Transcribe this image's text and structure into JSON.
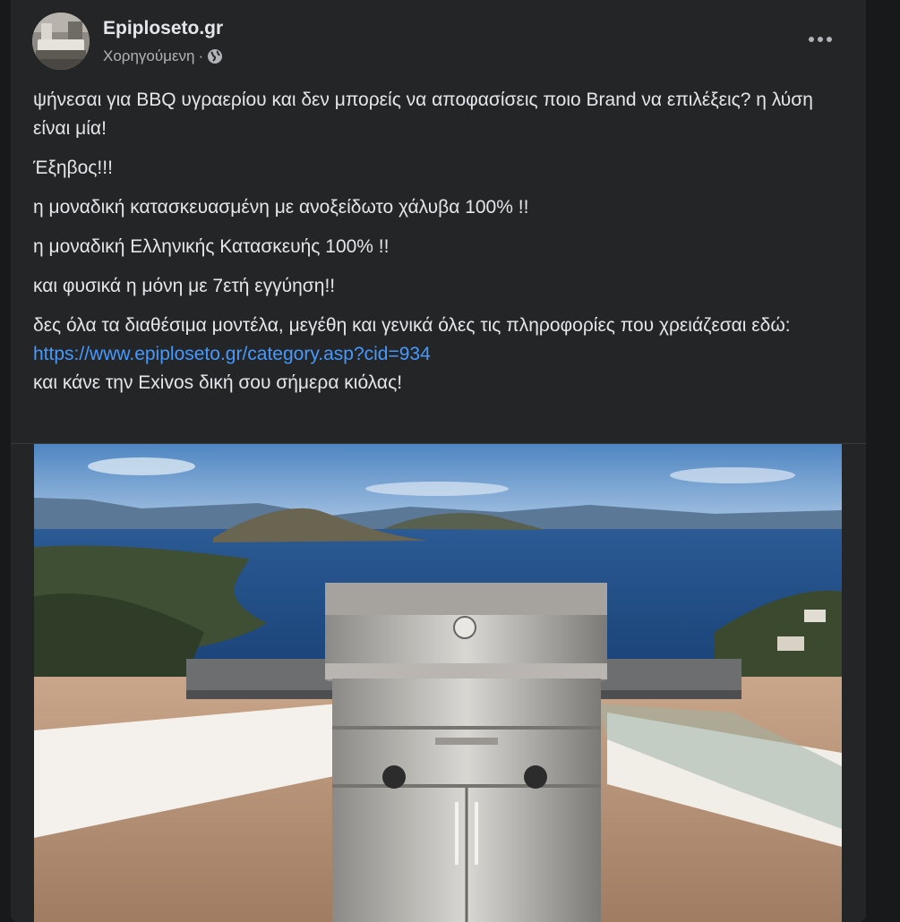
{
  "post": {
    "page_name": "Epiploseto.gr",
    "sponsored_label": "Χορηγούμενη",
    "separator": "·",
    "privacy_icon": "globe-icon",
    "more_icon": "more-options-icon",
    "lines": {
      "intro": "ψήνεσαι για BBQ υγραερίου και δεν μπορείς να αποφασίσεις ποιο Brand να επιλέξεις? η λύση είναι μία!",
      "brand": " Έξηβος!!!",
      "steel": "η μοναδική κατασκευασμένη με ανοξείδωτο χάλυβα 100% !!",
      "greek": "η μοναδική Ελληνικής Κατασκευής 100% !!",
      "warranty": "και φυσικά η μόνη με 7ετή εγγύηση!!",
      "models": "δες όλα τα διαθέσιμα μοντέλα, μεγέθη και γενικά όλες τις πληροφορίες που χρειάζεσαι εδώ:",
      "url": "https://www.epiploseto.gr/category.asp?cid=934",
      "cta": "και κάνε την Exivos δική σου σήμερα κιόλας!"
    },
    "colors": {
      "background": "#18191a",
      "card": "#242526",
      "text": "#e4e6eb",
      "secondary": "#b0b3b8",
      "link": "#4599ff"
    }
  }
}
